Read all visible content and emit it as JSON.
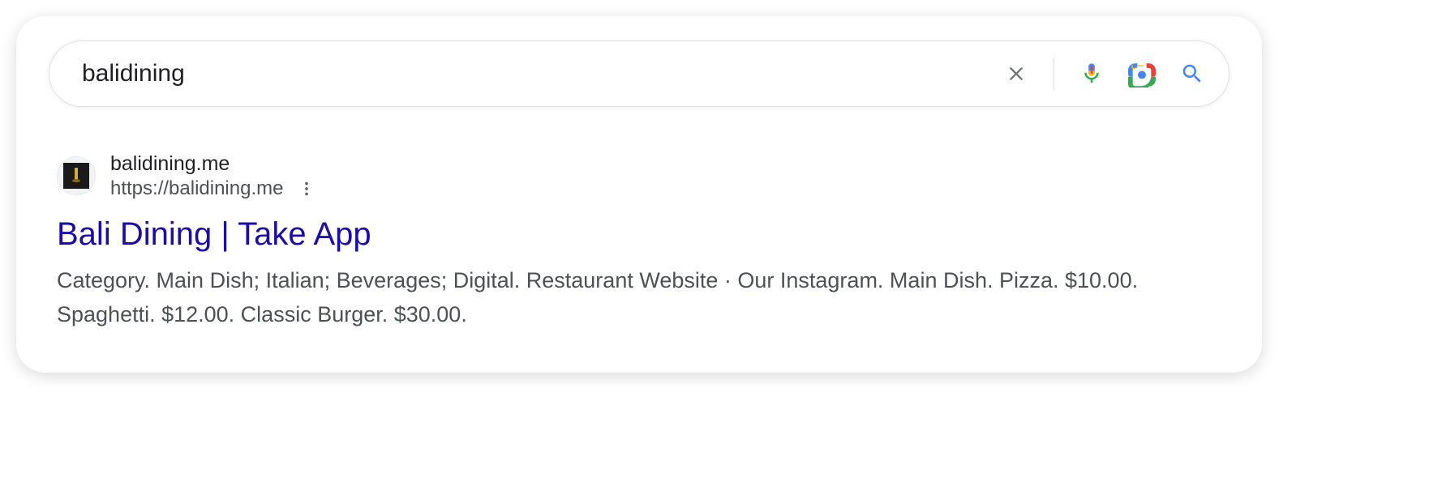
{
  "search": {
    "query": "balidining"
  },
  "result": {
    "site_name": "balidining.me",
    "site_url": "https://balidining.me",
    "title": "Bali Dining | Take App",
    "snippet": "Category. Main Dish; Italian; Beverages; Digital. Restaurant Website · Our Instagram. Main Dish. Pizza. $10.00. Spaghetti. $12.00. Classic Burger. $30.00."
  }
}
